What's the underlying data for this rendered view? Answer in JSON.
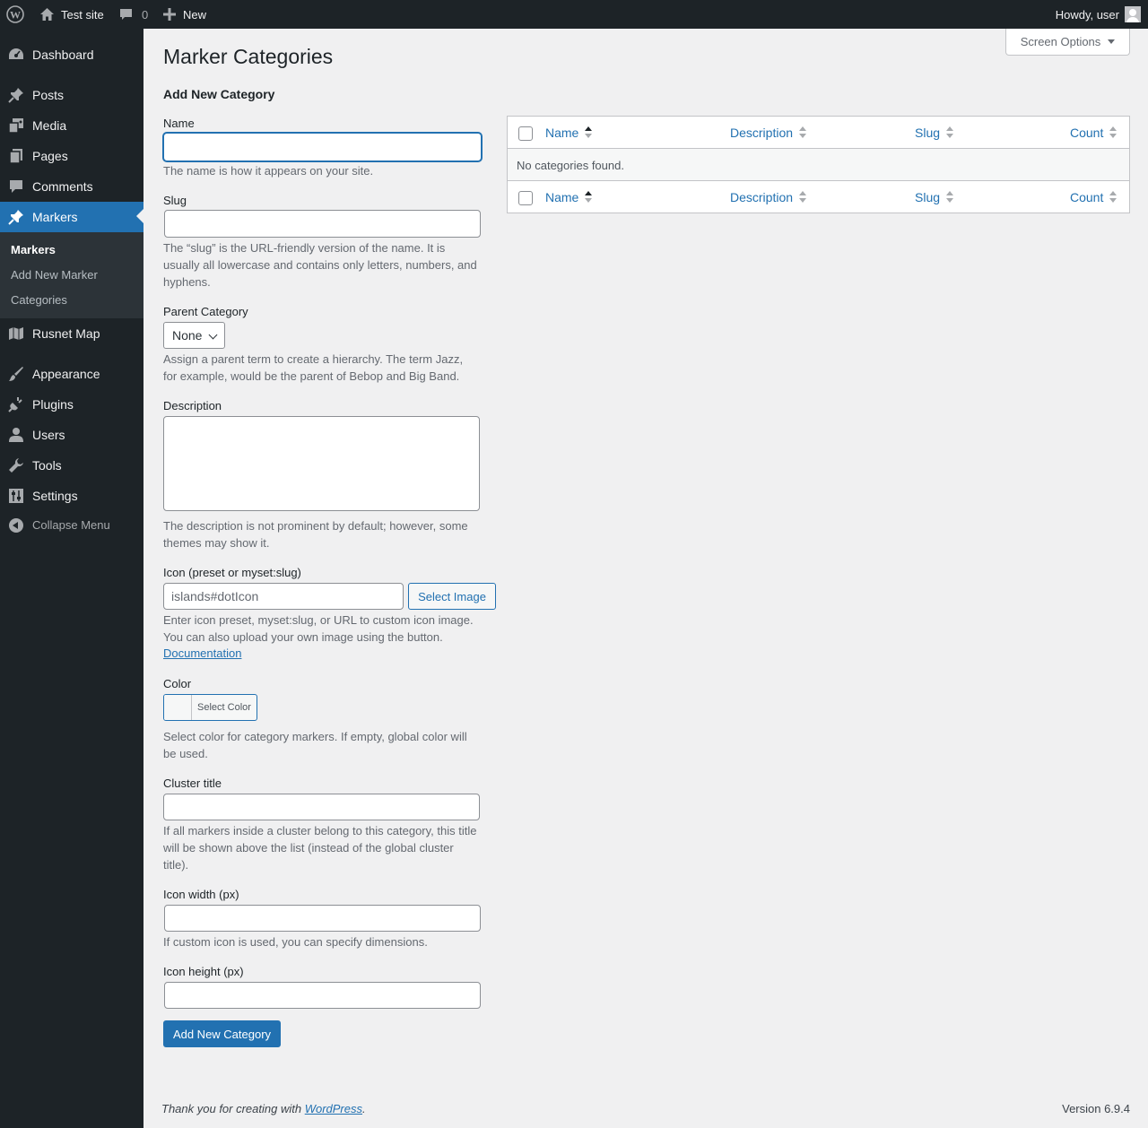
{
  "admin_bar": {
    "site_name": "Test site",
    "comments_count": "0",
    "new_label": "New",
    "howdy": "Howdy, user"
  },
  "sidebar": {
    "items": [
      {
        "label": "Dashboard",
        "icon": "dashboard-icon"
      },
      {
        "label": "Posts",
        "icon": "pin-icon"
      },
      {
        "label": "Media",
        "icon": "media-icon"
      },
      {
        "label": "Pages",
        "icon": "pages-icon"
      },
      {
        "label": "Comments",
        "icon": "comment-icon"
      },
      {
        "label": "Markers",
        "icon": "pin-icon"
      },
      {
        "label": "Rusnet Map",
        "icon": "map-icon"
      },
      {
        "label": "Appearance",
        "icon": "brush-icon"
      },
      {
        "label": "Plugins",
        "icon": "plug-icon"
      },
      {
        "label": "Users",
        "icon": "user-icon"
      },
      {
        "label": "Tools",
        "icon": "wrench-icon"
      },
      {
        "label": "Settings",
        "icon": "settings-icon"
      }
    ],
    "submenu": [
      "Markers",
      "Add New Marker",
      "Categories"
    ],
    "collapse_label": "Collapse Menu"
  },
  "screen_options": "Screen Options",
  "page_title": "Marker Categories",
  "form": {
    "title": "Add New Category",
    "name_label": "Name",
    "name_value": "",
    "name_help": "The name is how it appears on your site.",
    "slug_label": "Slug",
    "slug_value": "",
    "slug_help": "The “slug” is the URL-friendly version of the name. It is usually all lowercase and contains only letters, numbers, and hyphens.",
    "parent_label": "Parent Category",
    "parent_value": "None",
    "parent_help": "Assign a parent term to create a hierarchy. The term Jazz, for example, would be the parent of Bebop and Big Band.",
    "description_label": "Description",
    "description_value": "",
    "description_help": "The description is not prominent by default; however, some themes may show it.",
    "icon_label": "Icon (preset or myset:slug)",
    "icon_placeholder": "islands#dotIcon",
    "select_image": "Select Image",
    "icon_help": "Enter icon preset, myset:slug, or URL to custom icon image. You can also upload your own image using the button.",
    "documentation": "Documentation",
    "color_label": "Color",
    "select_color": "Select Color",
    "color_help": "Select color for category markers. If empty, global color will be used.",
    "cluster_label": "Cluster title",
    "cluster_value": "",
    "cluster_help": "If all markers inside a cluster belong to this category, this title will be shown above the list (instead of the global cluster title).",
    "icon_width_label": "Icon width (px)",
    "icon_width_value": "",
    "icon_size_help": "If custom icon is used, you can specify dimensions.",
    "icon_height_label": "Icon height (px)",
    "icon_height_value": "",
    "submit": "Add New Category"
  },
  "table": {
    "columns": [
      "Name",
      "Description",
      "Slug",
      "Count"
    ],
    "sorted_column": "Name",
    "empty_message": "No categories found."
  },
  "footer": {
    "thanks_prefix": "Thank you for creating with ",
    "thanks_link": "WordPress",
    "thanks_suffix": ".",
    "version": "Version 6.9.4"
  }
}
